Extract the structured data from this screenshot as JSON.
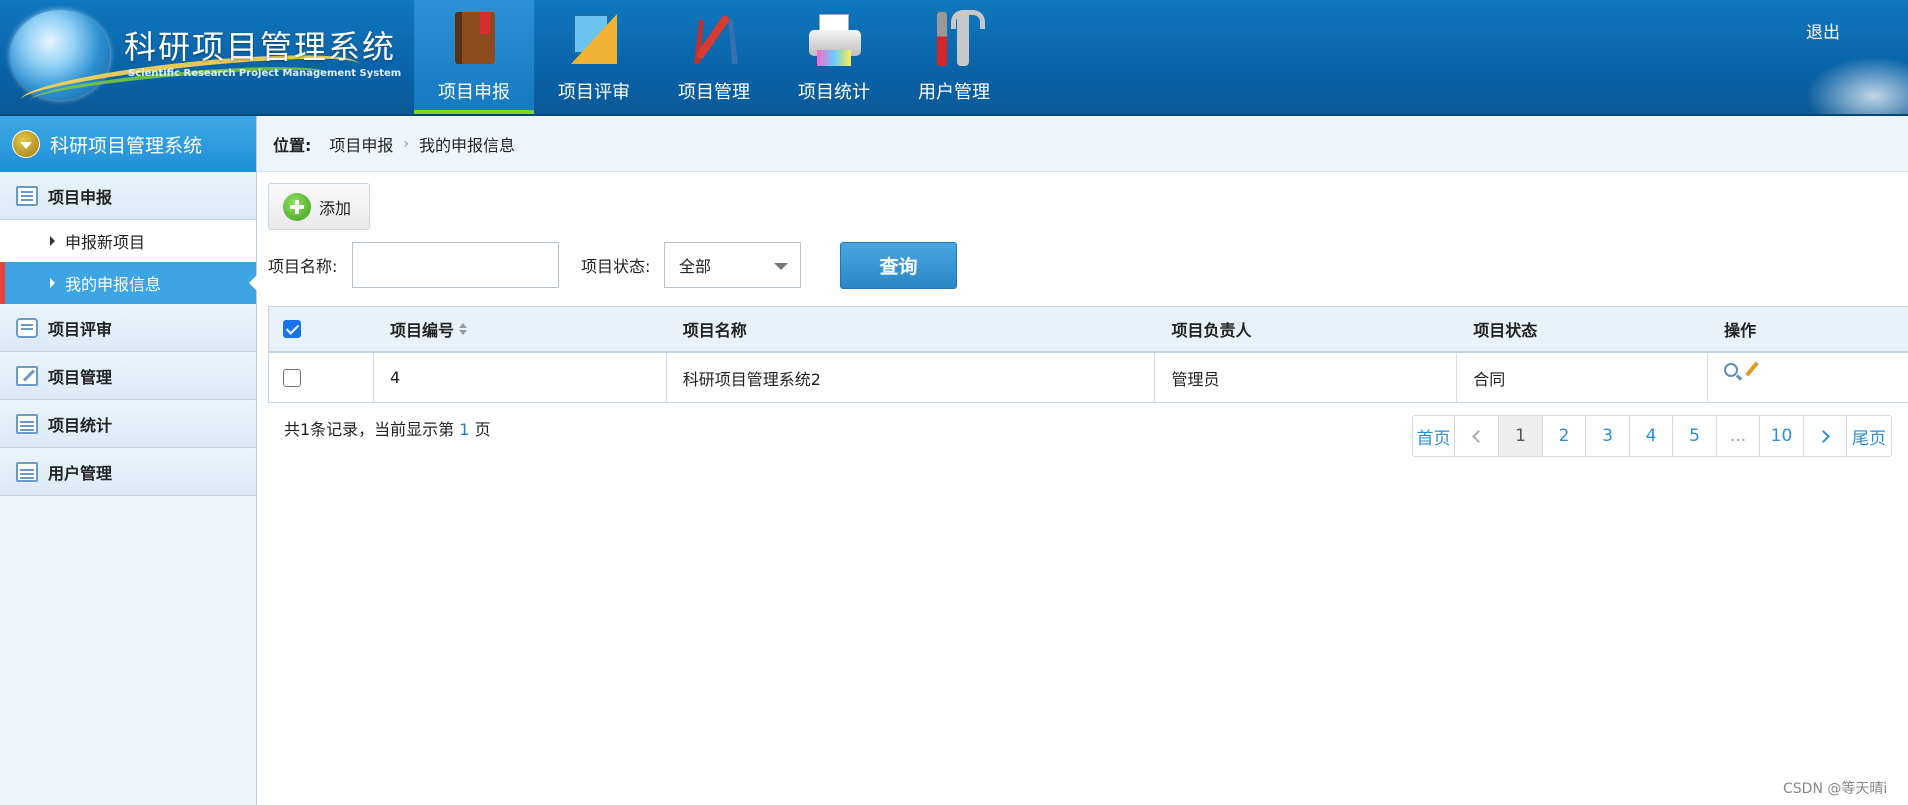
{
  "header": {
    "title": "科研项目管理系统",
    "subtitle": "Scientific Research Project Management System",
    "nav": [
      {
        "label": "项目申报",
        "icon": "book-icon",
        "active": true
      },
      {
        "label": "项目评审",
        "icon": "ruler-icon"
      },
      {
        "label": "项目管理",
        "icon": "compass-icon"
      },
      {
        "label": "项目统计",
        "icon": "printer-icon"
      },
      {
        "label": "用户管理",
        "icon": "tools-icon"
      }
    ],
    "logout": "退出"
  },
  "sidebar": {
    "title": "科研项目管理系统",
    "groups": [
      {
        "label": "项目申报",
        "icon": "list-icon"
      },
      {
        "label": "项目评审",
        "icon": "chat-icon"
      },
      {
        "label": "项目管理",
        "icon": "edit-icon"
      },
      {
        "label": "项目统计",
        "icon": "calendar-icon"
      },
      {
        "label": "用户管理",
        "icon": "calendar-icon"
      }
    ],
    "sub_items": [
      {
        "label": "申报新项目"
      },
      {
        "label": "我的申报信息",
        "active": true
      }
    ]
  },
  "breadcrumb": {
    "label": "位置:",
    "items": [
      "项目申报",
      "我的申报信息"
    ]
  },
  "toolbar": {
    "add_label": "添加"
  },
  "filters": {
    "name_label": "项目名称:",
    "name_value": "",
    "status_label": "项目状态:",
    "status_value": "全部",
    "query_label": "查询"
  },
  "table": {
    "headers": [
      "项目编号",
      "项目名称",
      "项目负责人",
      "项目状态",
      "操作"
    ],
    "rows": [
      {
        "id": "4",
        "name": "科研项目管理系统2",
        "owner": "管理员",
        "status": "合同"
      }
    ]
  },
  "footer": {
    "records_prefix": "共1条记录，当前显示第",
    "current_page": "1",
    "records_suffix": "页"
  },
  "pagination": {
    "first": "首页",
    "pages": [
      "1",
      "2",
      "3",
      "4",
      "5",
      "...",
      "10"
    ],
    "last": "尾页"
  },
  "watermark": "CSDN @等天晴i",
  "colors": {
    "header_blue": "#0a63a8",
    "active_nav": "#1679c0",
    "active_indicator": "#7ed321",
    "sidebar_active": "#3da5e3",
    "query_button": "#2a86c6",
    "link_blue": "#2d8ed6"
  }
}
